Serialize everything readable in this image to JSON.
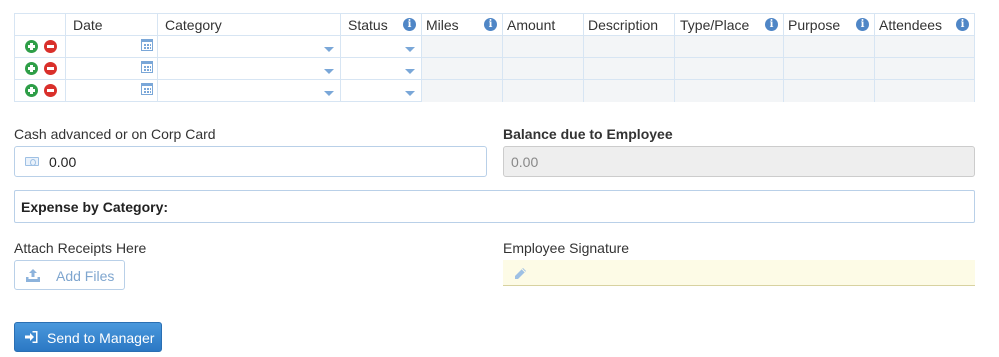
{
  "table": {
    "columns": [
      "Date",
      "Category",
      "Status",
      "Miles",
      "Amount",
      "Description",
      "Type/Place",
      "Purpose",
      "Attendees"
    ],
    "info_columns": [
      "Status",
      "Miles",
      "Type/Place",
      "Purpose",
      "Attendees"
    ],
    "rows": [
      {
        "date": "",
        "category": "",
        "status": "",
        "miles": "",
        "amount": "",
        "description": "",
        "type_place": "",
        "purpose": "",
        "attendees": ""
      },
      {
        "date": "",
        "category": "",
        "status": "",
        "miles": "",
        "amount": "",
        "description": "",
        "type_place": "",
        "purpose": "",
        "attendees": ""
      },
      {
        "date": "",
        "category": "",
        "status": "",
        "miles": "",
        "amount": "",
        "description": "",
        "type_place": "",
        "purpose": "",
        "attendees": ""
      }
    ]
  },
  "form": {
    "cash_label": "Cash advanced or on Corp Card",
    "cash_value": "0.00",
    "balance_label": "Balance due to Employee",
    "balance_value": "0.00",
    "expense_by_category_label": "Expense by Category:",
    "attach_label": "Attach Receipts Here",
    "add_files_label": "Add Files",
    "signature_label": "Employee Signature",
    "signature_value": "",
    "send_button_label": "Send to Manager"
  },
  "icons": {
    "add_row": "plus-circle-icon",
    "remove_row": "minus-circle-icon",
    "date_picker": "calendar-icon",
    "dropdown": "caret-down-icon",
    "info": "info-icon",
    "cash": "money-icon",
    "upload": "upload-icon",
    "signature": "pencil-icon",
    "send": "sign-in-icon"
  },
  "colors": {
    "accent": "#2b78c4",
    "add": "#2e9e47",
    "remove": "#d9302b",
    "signature_bg": "#fdfbe6"
  }
}
